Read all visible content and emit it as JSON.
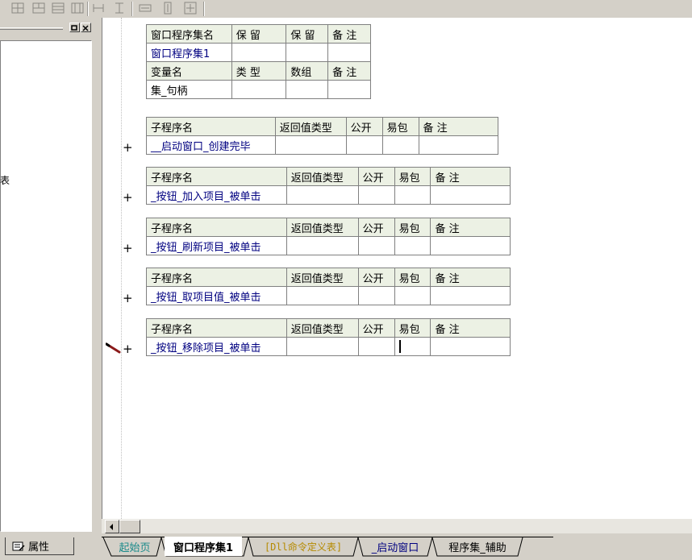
{
  "colors": {
    "chrome": "#d4d0c8",
    "header_fill": "#ecf1e4",
    "code_blue": "#000080",
    "tab_start_green": "#1a8a8a",
    "tab_dll_gold": "#b58a00"
  },
  "icons": [
    "table-icon",
    "table-icon",
    "table-icon",
    "table-icon",
    "column-icon",
    "column-icon",
    "width-icon",
    "height-icon",
    "size-icon"
  ],
  "panel": {
    "truncated_text": "表",
    "tab_label": "属性"
  },
  "program_set_table": {
    "header1": [
      "窗口程序集名",
      "保 留",
      "保 留",
      "备 注"
    ],
    "row1": [
      "窗口程序集1",
      "",
      "",
      ""
    ],
    "header2": [
      "变量名",
      "类 型",
      "数组",
      "备 注"
    ],
    "row2": [
      "集_句柄",
      "",
      "",
      ""
    ]
  },
  "sub_header": [
    "子程序名",
    "返回值类型",
    "公开",
    "易包",
    "备 注"
  ],
  "subroutines": [
    {
      "name": "__启动窗口_创建完毕",
      "plus": "+"
    },
    {
      "name": "_按钮_加入项目_被单击",
      "plus": "+"
    },
    {
      "name": "_按钮_刷新项目_被单击",
      "plus": "+"
    },
    {
      "name": "_按钮_取项目值_被单击",
      "plus": "+"
    },
    {
      "name": "_按钮_移除项目_被单击",
      "plus": "+"
    }
  ],
  "tabs": [
    {
      "label": "起始页"
    },
    {
      "label": "窗口程序集1"
    },
    {
      "label": "[Dll命令定义表]"
    },
    {
      "label": "_启动窗口"
    },
    {
      "label": "程序集_辅助"
    }
  ]
}
